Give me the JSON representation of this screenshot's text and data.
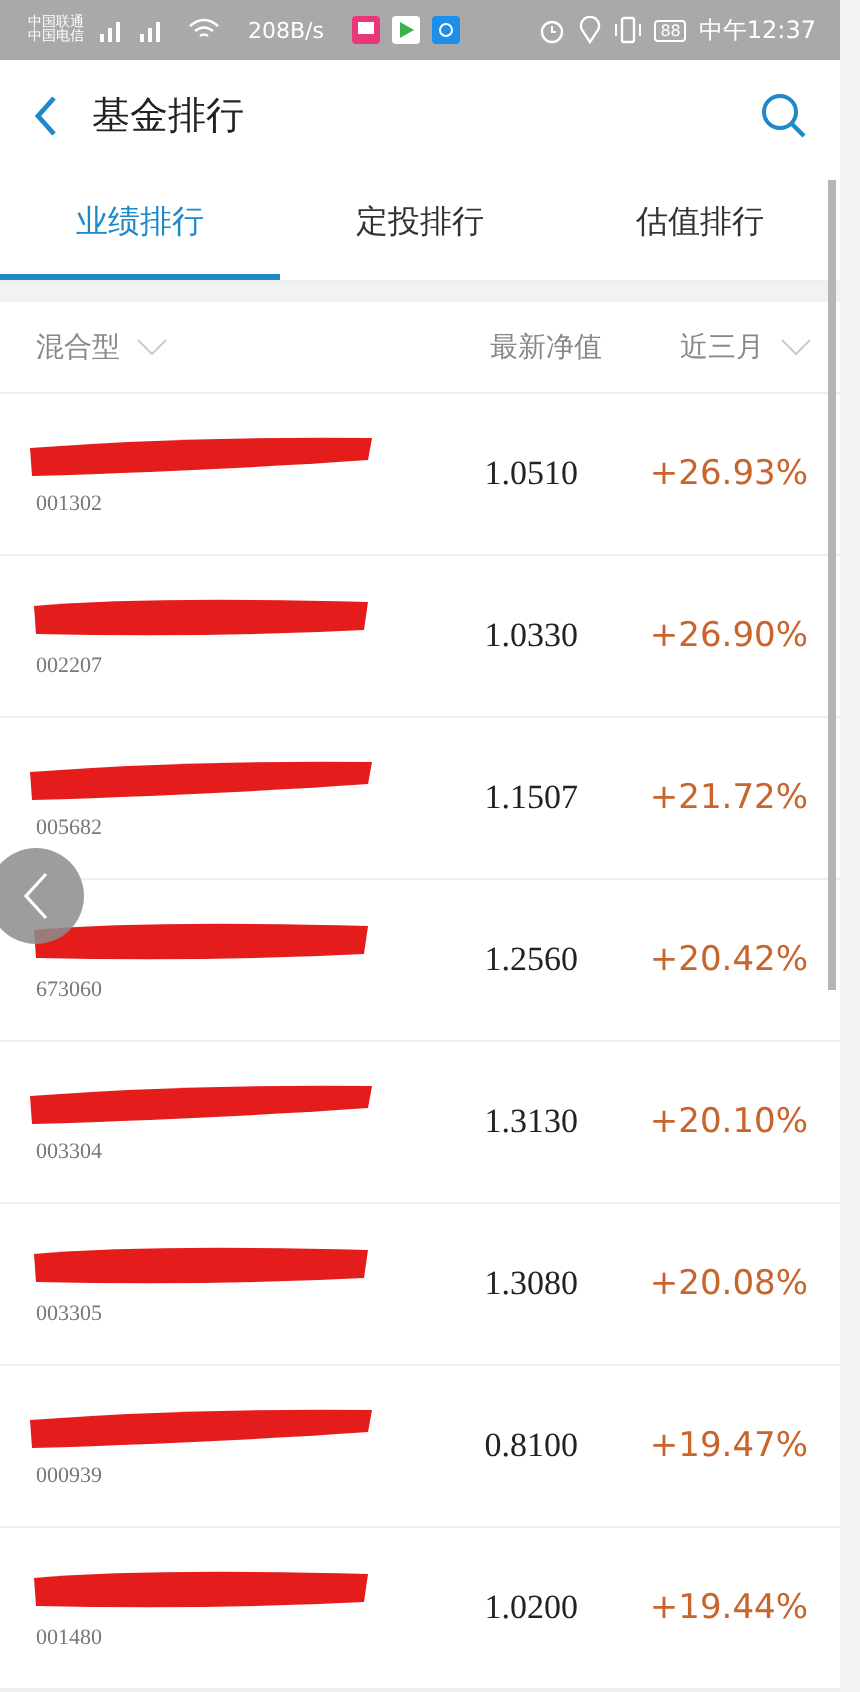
{
  "status_bar": {
    "carriers": [
      "中国联通",
      "中国电信"
    ],
    "network_speed": "208B/s",
    "battery": "88",
    "time": "中午12:37"
  },
  "header": {
    "title": "基金排行"
  },
  "tabs": [
    {
      "label": "业绩排行",
      "selected": true
    },
    {
      "label": "定投排行",
      "selected": false
    },
    {
      "label": "估值排行",
      "selected": false
    }
  ],
  "columns": {
    "category": "混合型",
    "nav": "最新净值",
    "period": "近三月"
  },
  "funds": [
    {
      "code": "001302",
      "nav": "1.0510",
      "change": "+26.93%"
    },
    {
      "code": "002207",
      "nav": "1.0330",
      "change": "+26.90%"
    },
    {
      "code": "005682",
      "nav": "1.1507",
      "change": "+21.72%"
    },
    {
      "code": "673060",
      "nav": "1.2560",
      "change": "+20.42%"
    },
    {
      "code": "003304",
      "nav": "1.3130",
      "change": "+20.10%"
    },
    {
      "code": "003305",
      "nav": "1.3080",
      "change": "+20.08%"
    },
    {
      "code": "000939",
      "nav": "0.8100",
      "change": "+19.47%"
    },
    {
      "code": "001480",
      "nav": "1.0200",
      "change": "+19.44%"
    }
  ]
}
